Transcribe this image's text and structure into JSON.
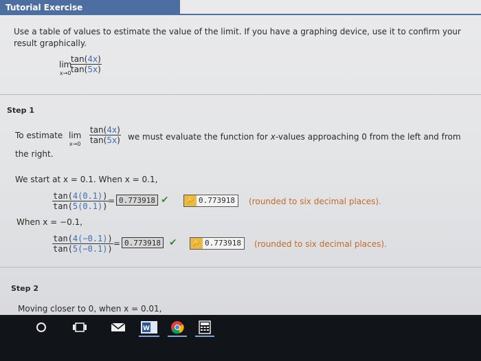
{
  "header": {
    "title": "Tutorial Exercise"
  },
  "problem": {
    "line1": "Use a table of values to estimate the value of the limit. If you have a graphing device, use it to confirm your",
    "line2": "result graphically.",
    "lim": "lim",
    "lim_sub": "x→0",
    "num_a": "tan(",
    "num_b": "4x",
    "num_c": ")",
    "den_a": "tan(",
    "den_b": "5x",
    "den_c": ")"
  },
  "step1": {
    "label": "Step 1",
    "intro_a": "To estimate",
    "intro_b": "we must evaluate the function for",
    "intro_x": "x",
    "intro_c": "-values approaching 0 from the left and from",
    "intro_d": "the right.",
    "start_line": "We start at x = 0.1. When x = 0.1,",
    "row1": {
      "num_a": "tan(",
      "num_b": "4(0.1)",
      "num_c": ")",
      "den_a": "tan(",
      "den_b": "5(0.1)",
      "den_c": ")",
      "eq": "=",
      "answer": "0.773918",
      "key_value": "0.773918",
      "note": "(rounded to six decimal places)."
    },
    "when_line": "When x = −0.1,",
    "row2": {
      "num_a": "tan(",
      "num_b": "4(−0.1)",
      "num_c": ")",
      "den_a": "tan(",
      "den_b": "5(−0.1)",
      "den_c": ")",
      "eq": "=",
      "answer": "0.773918",
      "key_value": "0.773918",
      "note": "(rounded to six decimal places)."
    },
    "check_glyph": "✔"
  },
  "step2": {
    "label": "Step 2",
    "line": "Moving closer to 0, when x = 0.01,"
  },
  "taskbar": {
    "word_label": "W"
  },
  "colors": {
    "header": "#4c6ea0",
    "accent_blue": "#3f6fb0",
    "accent_orange": "#c26a2a",
    "check": "#3c8d3c"
  }
}
